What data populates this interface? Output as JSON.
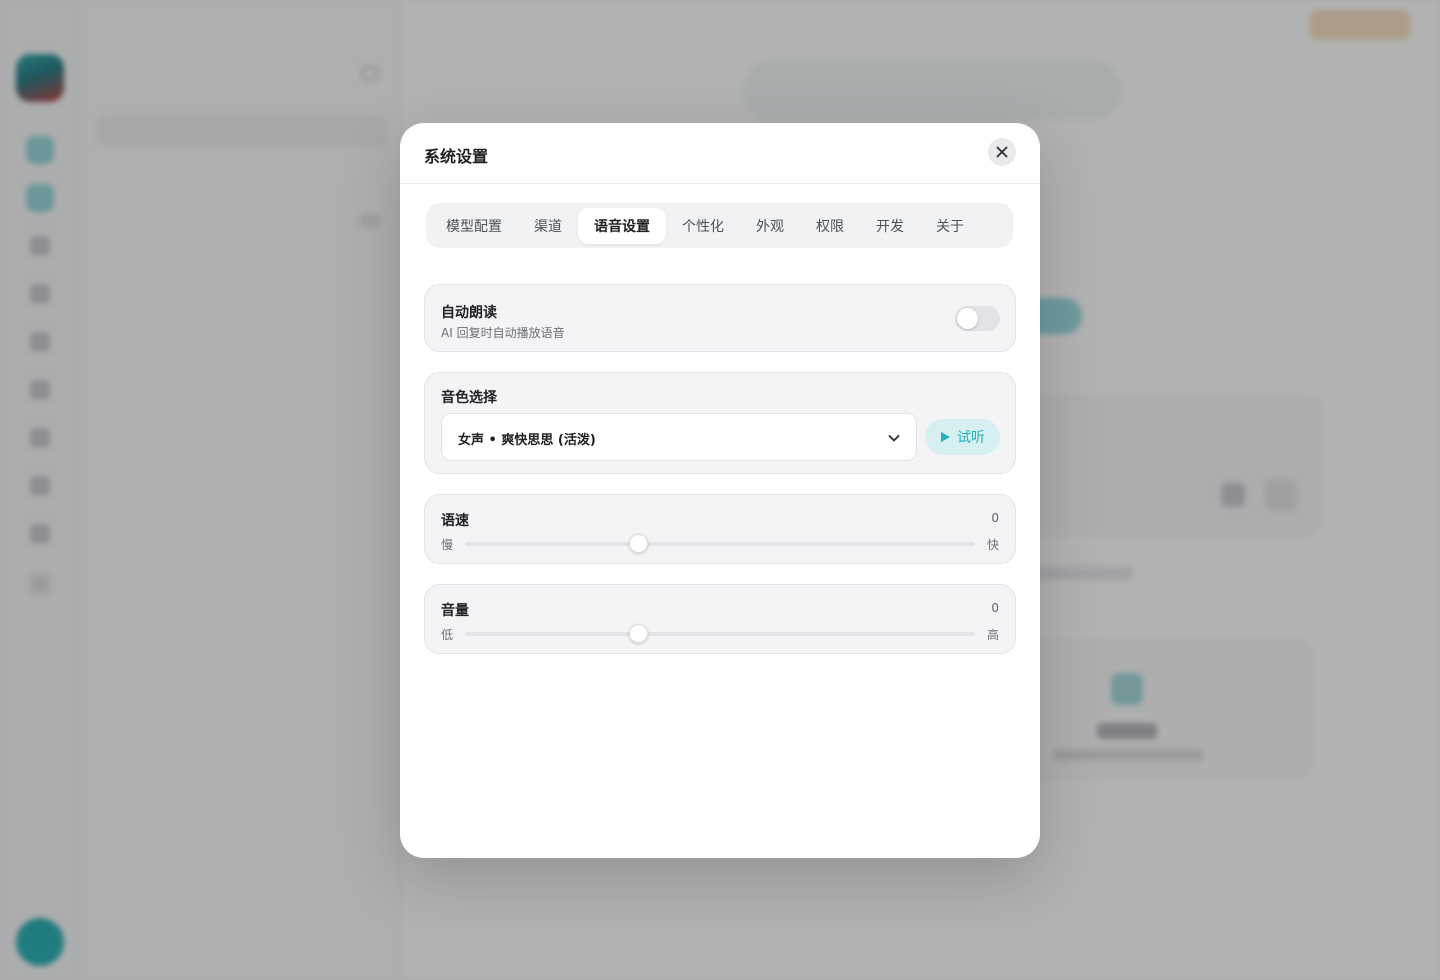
{
  "background": {
    "sidebar_title": "",
    "search_placeholder": "",
    "group_label": "",
    "conversation_label": ""
  },
  "modal": {
    "title": "系统设置",
    "tabs": [
      {
        "label": "模型配置",
        "active": false
      },
      {
        "label": "渠道",
        "active": false
      },
      {
        "label": "语音设置",
        "active": true
      },
      {
        "label": "个性化",
        "active": false
      },
      {
        "label": "外观",
        "active": false
      },
      {
        "label": "权限",
        "active": false
      },
      {
        "label": "开发",
        "active": false
      },
      {
        "label": "关于",
        "active": false
      }
    ],
    "auto_read": {
      "label": "自动朗读",
      "description": "AI 回复时自动播放语音",
      "enabled": false
    },
    "voice": {
      "label": "音色选择",
      "selected": "女声 • 爽快思思 (活泼)",
      "preview_label": "试听"
    },
    "speed": {
      "label": "语速",
      "value_text": "0",
      "min_label": "慢",
      "max_label": "快",
      "level": 0.34
    },
    "volume": {
      "label": "音量",
      "value_text": "0",
      "min_label": "低",
      "max_label": "高",
      "level": 0.34
    }
  },
  "colors": {
    "accent": "#1fb3b7",
    "accent_soft": "#d6eff0",
    "overlay": "rgba(0,0,0,0.30)"
  },
  "icons": {
    "close": "close-icon",
    "chevron": "chevron-down-icon",
    "play": "play-icon"
  }
}
